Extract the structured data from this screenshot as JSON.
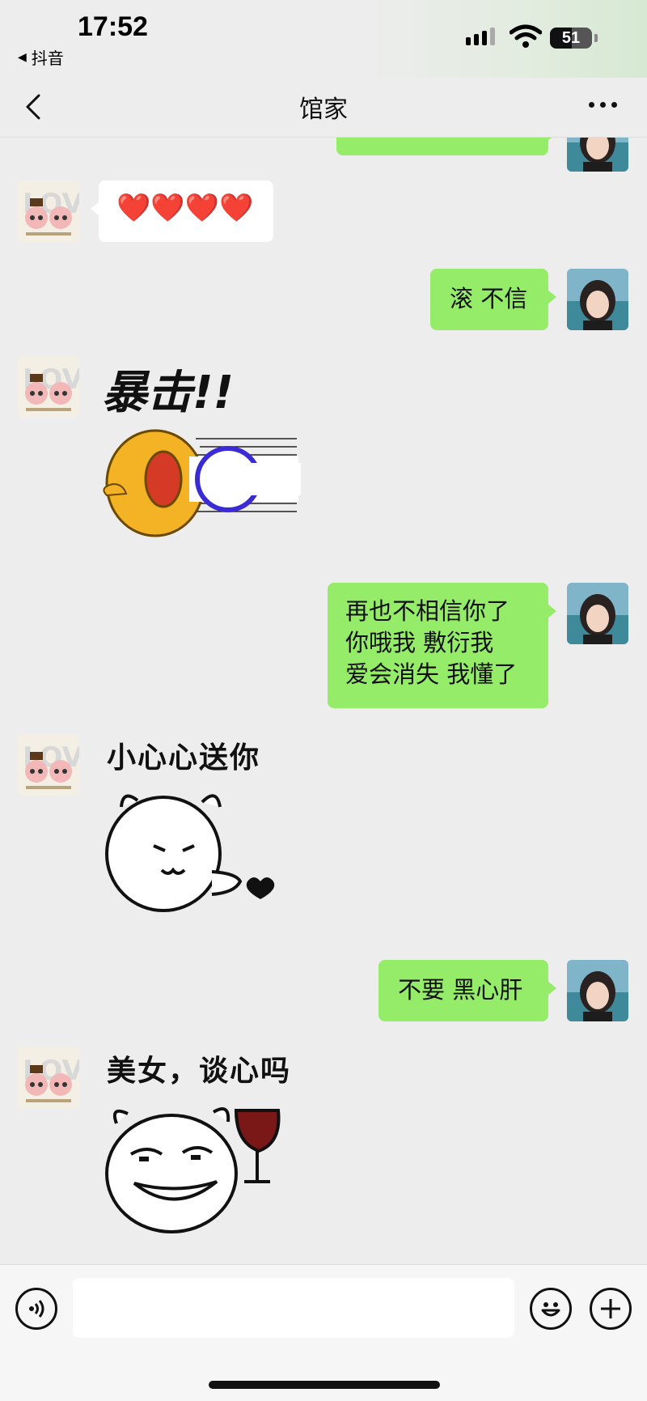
{
  "status_bar": {
    "time": "17:52",
    "back_app": "抖音",
    "battery": "51"
  },
  "nav": {
    "title": "馆家"
  },
  "messages": [
    {
      "side": "them",
      "type": "text",
      "text": "❤️❤️❤️❤️"
    },
    {
      "side": "me",
      "type": "text",
      "text": "滚 不信"
    },
    {
      "side": "them",
      "type": "sticker",
      "caption": "暴击!!"
    },
    {
      "side": "me",
      "type": "text",
      "text": "再也不相信你了\n你哦我 敷衍我\n爱会消失 我懂了"
    },
    {
      "side": "them",
      "type": "sticker",
      "caption": "小心心送你"
    },
    {
      "side": "me",
      "type": "text",
      "text": "不要 黑心肝"
    },
    {
      "side": "them",
      "type": "sticker",
      "caption": "美女，谈心吗"
    }
  ],
  "avatar_left_label": "LOVE",
  "colors": {
    "my_bubble": "#95ec69",
    "their_bubble": "#ffffff",
    "background": "#ededed"
  },
  "icons": {
    "voice": "voice-icon",
    "emoji": "emoji-icon",
    "plus": "plus-icon",
    "more": "more-icon",
    "back": "back-arrow-icon"
  }
}
